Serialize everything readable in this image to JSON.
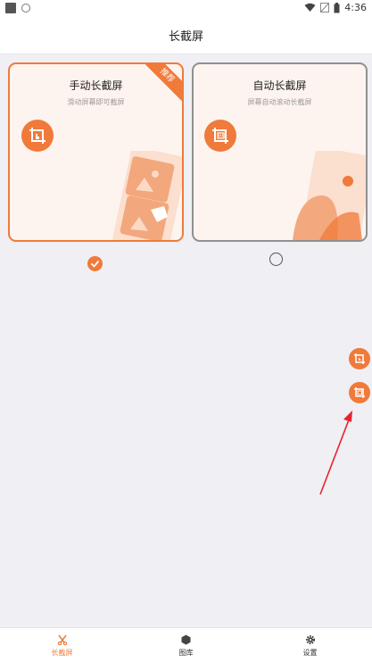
{
  "status_bar": {
    "time": "4:36"
  },
  "header": {
    "title": "长截屏"
  },
  "modes": [
    {
      "title": "手动长截屏",
      "subtitle": "滑动屏幕即可截屏",
      "badge": "推荐",
      "icon": "manual-crop-icon",
      "selected": true
    },
    {
      "title": "自动长截屏",
      "subtitle": "屏幕自动滚动长截屏",
      "icon": "auto-crop-icon",
      "selected": false
    }
  ],
  "floating_buttons": [
    {
      "icon": "manual-screenshot-icon"
    },
    {
      "icon": "auto-screenshot-icon"
    }
  ],
  "bottom_nav": {
    "items": [
      {
        "label": "长截屏",
        "icon": "scissors-icon",
        "active": true
      },
      {
        "label": "图库",
        "icon": "hexagon-icon",
        "active": false
      },
      {
        "label": "设置",
        "icon": "gear-icon",
        "active": false
      }
    ]
  },
  "colors": {
    "accent": "#f07a3a",
    "card_background": "#fdf4ef",
    "page_background": "#efeff4"
  }
}
